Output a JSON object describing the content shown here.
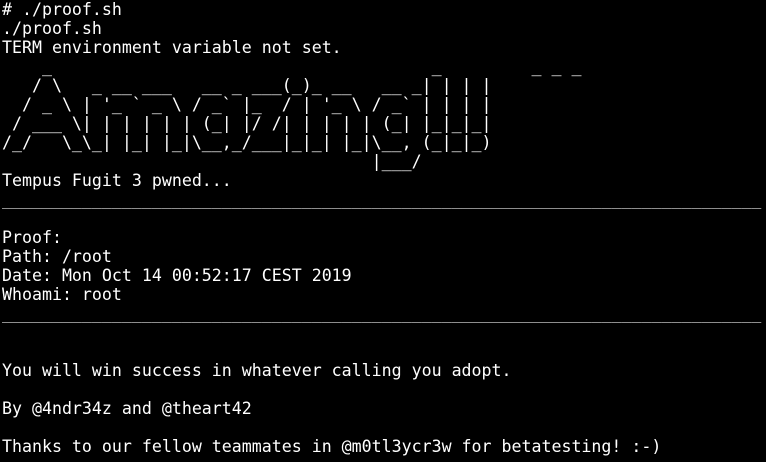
{
  "terminal": {
    "prompt_command": "# ./proof.sh",
    "echo_command": "./proof.sh",
    "term_warning": "TERM environment variable not set.",
    "banner": "    _                                      _         _ _ _\n   / \\   _ __ ___   __ _ ___(_)_ __   __ _| | | |\n  / _ \\ | '_ ` _ \\ / _` |_  / | '_ \\ / _` | | | |\n / ___ \\| | | | | | (_| |/ /| | | | | (_| |_|_|_|\n/_/   \\_\\_| |_| |_|\\__,_/___|_|_| |_|\\__, (_|_|_)\n                                     |___/",
    "pwned_message": "Tempus Fugit 3 pwned...",
    "separator_top": "____________________________________________________________________________",
    "proof_label": "Proof:",
    "path_line": "Path: /root",
    "date_line": "Date: Mon Oct 14 00:52:17 CEST 2019",
    "whoami_line": "Whoami: root",
    "separator_bottom": "____________________________________________________________________________",
    "quote": "You will win success in whatever calling you adopt.",
    "authors": "By @4ndr34z and @theart42",
    "thanks": "Thanks to our fellow teammates in @m0tl3ycr3w for betatesting! :-)"
  },
  "colors": {
    "background": "#000000",
    "foreground": "#ffffff"
  }
}
